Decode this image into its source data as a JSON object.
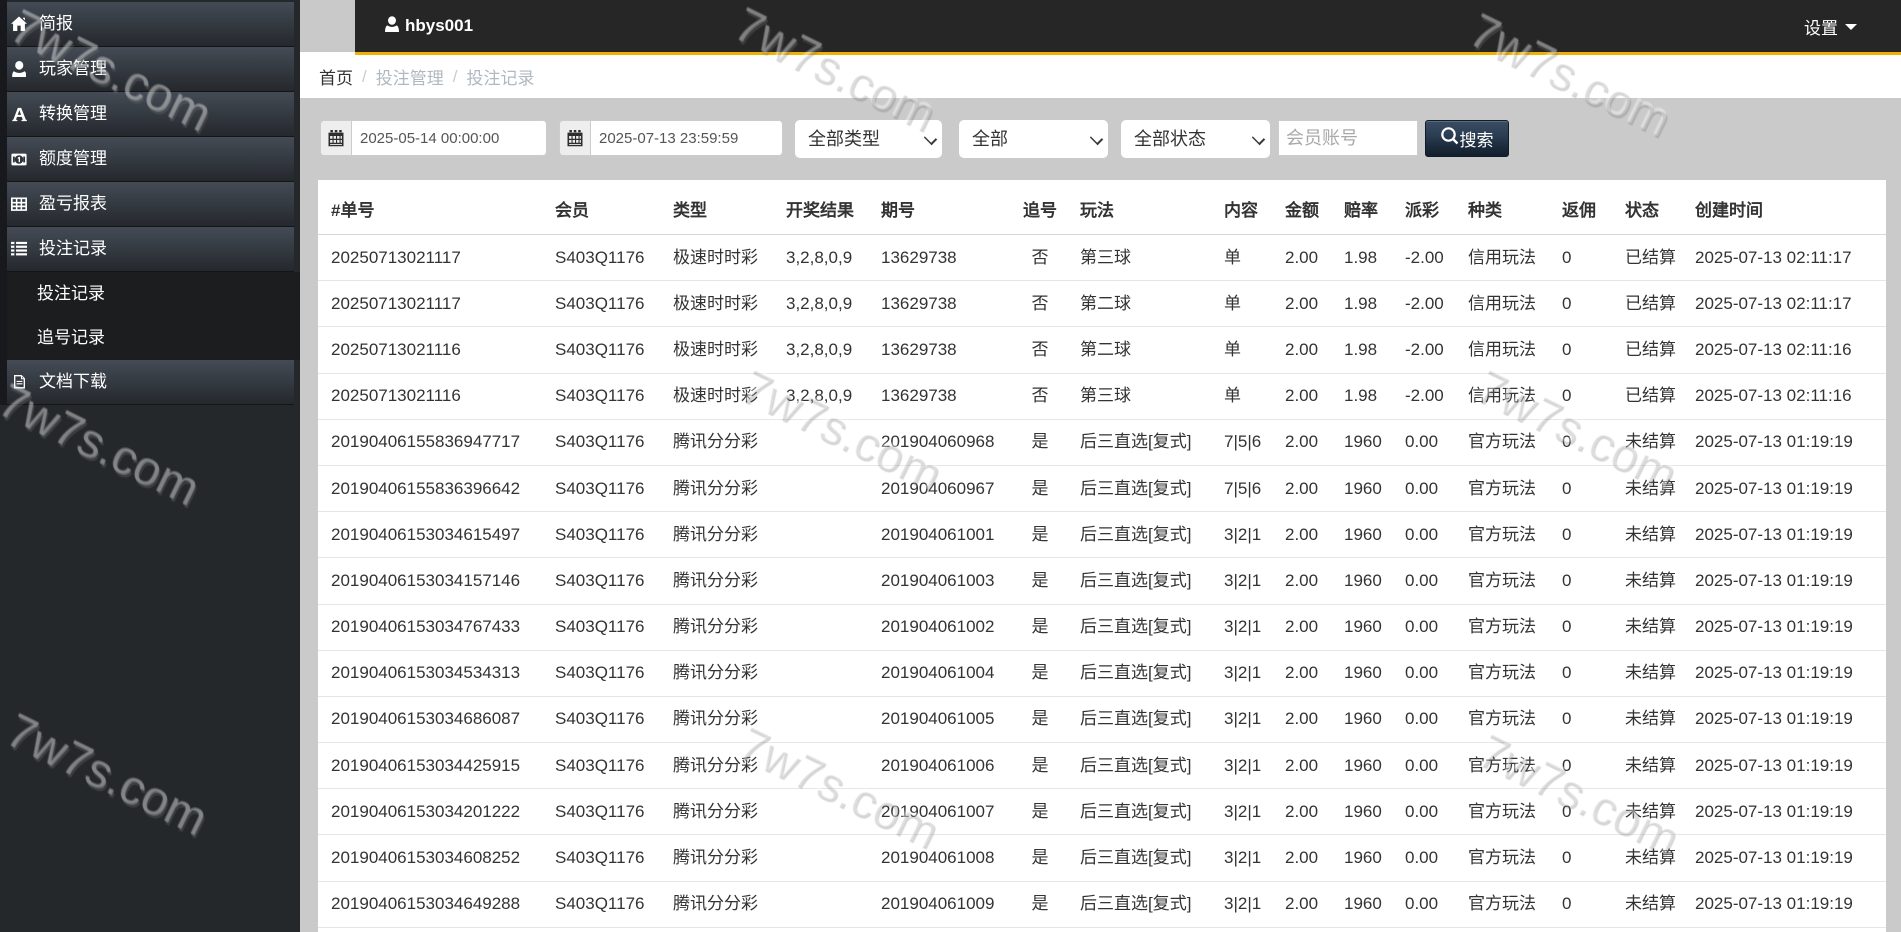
{
  "watermark": {
    "text": "7w7s.com"
  },
  "topbar": {
    "username": "hbys001",
    "settings_label": "设置"
  },
  "breadcrumb": {
    "home": "首页",
    "section": "投注管理",
    "page": "投注记录"
  },
  "sidebar": {
    "items": [
      {
        "label": "简报",
        "icon": "home-icon"
      },
      {
        "label": "玩家管理",
        "icon": "user-icon"
      },
      {
        "label": "转换管理",
        "icon": "font-icon"
      },
      {
        "label": "额度管理",
        "icon": "credit-icon"
      },
      {
        "label": "盈亏报表",
        "icon": "report-table-icon"
      },
      {
        "label": "投注记录",
        "icon": "list-icon"
      },
      {
        "label": "文档下载",
        "icon": "document-icon"
      }
    ],
    "submenu": [
      {
        "label": "投注记录"
      },
      {
        "label": "追号记录"
      }
    ]
  },
  "filters": {
    "date_from": "2025-05-14 00:00:00",
    "date_to": "2025-07-13 23:59:59",
    "type_select": "全部类型",
    "lottery_select": "全部",
    "status_select": "全部状态",
    "account_placeholder": "会员账号",
    "search_label": "搜索"
  },
  "table": {
    "columns": [
      "#单号",
      "会员",
      "类型",
      "开奖结果",
      "期号",
      "追号",
      "玩法",
      "内容",
      "金额",
      "赔率",
      "派彩",
      "种类",
      "返佣",
      "状态",
      "创建时间"
    ],
    "rows": [
      [
        "20250713021117",
        "S403Q1176",
        "极速时时彩",
        "3,2,8,0,9",
        "13629738",
        "否",
        "第三球",
        "单",
        "2.00",
        "1.98",
        "-2.00",
        "信用玩法",
        "0",
        "已结算",
        "2025-07-13 02:11:17"
      ],
      [
        "20250713021117",
        "S403Q1176",
        "极速时时彩",
        "3,2,8,0,9",
        "13629738",
        "否",
        "第二球",
        "单",
        "2.00",
        "1.98",
        "-2.00",
        "信用玩法",
        "0",
        "已结算",
        "2025-07-13 02:11:17"
      ],
      [
        "20250713021116",
        "S403Q1176",
        "极速时时彩",
        "3,2,8,0,9",
        "13629738",
        "否",
        "第二球",
        "单",
        "2.00",
        "1.98",
        "-2.00",
        "信用玩法",
        "0",
        "已结算",
        "2025-07-13 02:11:16"
      ],
      [
        "20250713021116",
        "S403Q1176",
        "极速时时彩",
        "3,2,8,0,9",
        "13629738",
        "否",
        "第三球",
        "单",
        "2.00",
        "1.98",
        "-2.00",
        "信用玩法",
        "0",
        "已结算",
        "2025-07-13 02:11:16"
      ],
      [
        "20190406155836947717",
        "S403Q1176",
        "腾讯分分彩",
        "",
        "201904060968",
        "是",
        "后三直选[复式]",
        "7|5|6",
        "2.00",
        "1960",
        "0.00",
        "官方玩法",
        "0",
        "未结算",
        "2025-07-13 01:19:19"
      ],
      [
        "20190406155836396642",
        "S403Q1176",
        "腾讯分分彩",
        "",
        "201904060967",
        "是",
        "后三直选[复式]",
        "7|5|6",
        "2.00",
        "1960",
        "0.00",
        "官方玩法",
        "0",
        "未结算",
        "2025-07-13 01:19:19"
      ],
      [
        "20190406153034615497",
        "S403Q1176",
        "腾讯分分彩",
        "",
        "201904061001",
        "是",
        "后三直选[复式]",
        "3|2|1",
        "2.00",
        "1960",
        "0.00",
        "官方玩法",
        "0",
        "未结算",
        "2025-07-13 01:19:19"
      ],
      [
        "20190406153034157146",
        "S403Q1176",
        "腾讯分分彩",
        "",
        "201904061003",
        "是",
        "后三直选[复式]",
        "3|2|1",
        "2.00",
        "1960",
        "0.00",
        "官方玩法",
        "0",
        "未结算",
        "2025-07-13 01:19:19"
      ],
      [
        "20190406153034767433",
        "S403Q1176",
        "腾讯分分彩",
        "",
        "201904061002",
        "是",
        "后三直选[复式]",
        "3|2|1",
        "2.00",
        "1960",
        "0.00",
        "官方玩法",
        "0",
        "未结算",
        "2025-07-13 01:19:19"
      ],
      [
        "20190406153034534313",
        "S403Q1176",
        "腾讯分分彩",
        "",
        "201904061004",
        "是",
        "后三直选[复式]",
        "3|2|1",
        "2.00",
        "1960",
        "0.00",
        "官方玩法",
        "0",
        "未结算",
        "2025-07-13 01:19:19"
      ],
      [
        "20190406153034686087",
        "S403Q1176",
        "腾讯分分彩",
        "",
        "201904061005",
        "是",
        "后三直选[复式]",
        "3|2|1",
        "2.00",
        "1960",
        "0.00",
        "官方玩法",
        "0",
        "未结算",
        "2025-07-13 01:19:19"
      ],
      [
        "20190406153034425915",
        "S403Q1176",
        "腾讯分分彩",
        "",
        "201904061006",
        "是",
        "后三直选[复式]",
        "3|2|1",
        "2.00",
        "1960",
        "0.00",
        "官方玩法",
        "0",
        "未结算",
        "2025-07-13 01:19:19"
      ],
      [
        "20190406153034201222",
        "S403Q1176",
        "腾讯分分彩",
        "",
        "201904061007",
        "是",
        "后三直选[复式]",
        "3|2|1",
        "2.00",
        "1960",
        "0.00",
        "官方玩法",
        "0",
        "未结算",
        "2025-07-13 01:19:19"
      ],
      [
        "20190406153034608252",
        "S403Q1176",
        "腾讯分分彩",
        "",
        "201904061008",
        "是",
        "后三直选[复式]",
        "3|2|1",
        "2.00",
        "1960",
        "0.00",
        "官方玩法",
        "0",
        "未结算",
        "2025-07-13 01:19:19"
      ],
      [
        "20190406153034649288",
        "S403Q1176",
        "腾讯分分彩",
        "",
        "201904061009",
        "是",
        "后三直选[复式]",
        "3|2|1",
        "2.00",
        "1960",
        "0.00",
        "官方玩法",
        "0",
        "未结算",
        "2025-07-13 01:19:19"
      ]
    ]
  }
}
